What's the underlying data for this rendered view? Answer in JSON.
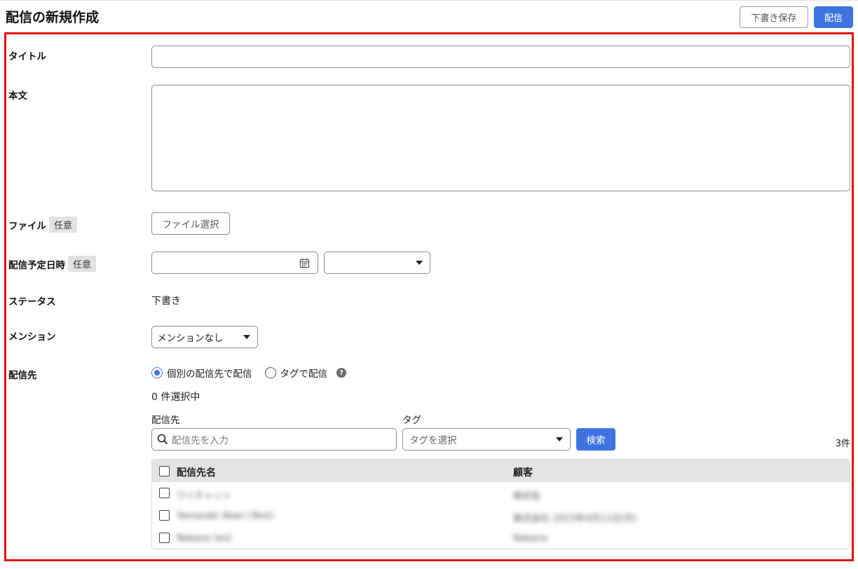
{
  "header": {
    "title": "配信の新規作成",
    "draft_button": "下書き保存",
    "send_button": "配信"
  },
  "form": {
    "title_label": "タイトル",
    "body_label": "本文",
    "file_label": "ファイル",
    "file_optional": "任意",
    "file_button": "ファイル選択",
    "schedule_label": "配信予定日時",
    "schedule_optional": "任意",
    "status_label": "ステータス",
    "status_value": "下書き",
    "mention_label": "メンション",
    "mention_value": "メンションなし",
    "destination_label": "配信先",
    "radio_individual": "個別の配信先で配信",
    "radio_tag": "タグで配信",
    "selected_count": "0 件選択中",
    "destination_sub_label": "配信先",
    "tag_sub_label": "タグ",
    "search_placeholder": "配信先を入力",
    "tag_placeholder": "タグを選択",
    "search_button": "検索",
    "result_count": "3件"
  },
  "table": {
    "columns": [
      "配信先名",
      "顧客"
    ],
    "rows": [
      {
        "name": "ワイチャット",
        "customer": "株式会"
      },
      {
        "name": "Yamasaki Akari (Test)",
        "customer": "株式会社 2023年4月11日(月)"
      },
      {
        "name": "Nakano test",
        "customer": "Nakano"
      }
    ]
  },
  "colors": {
    "accent": "#3f74e0",
    "highlight": "#e01212"
  }
}
